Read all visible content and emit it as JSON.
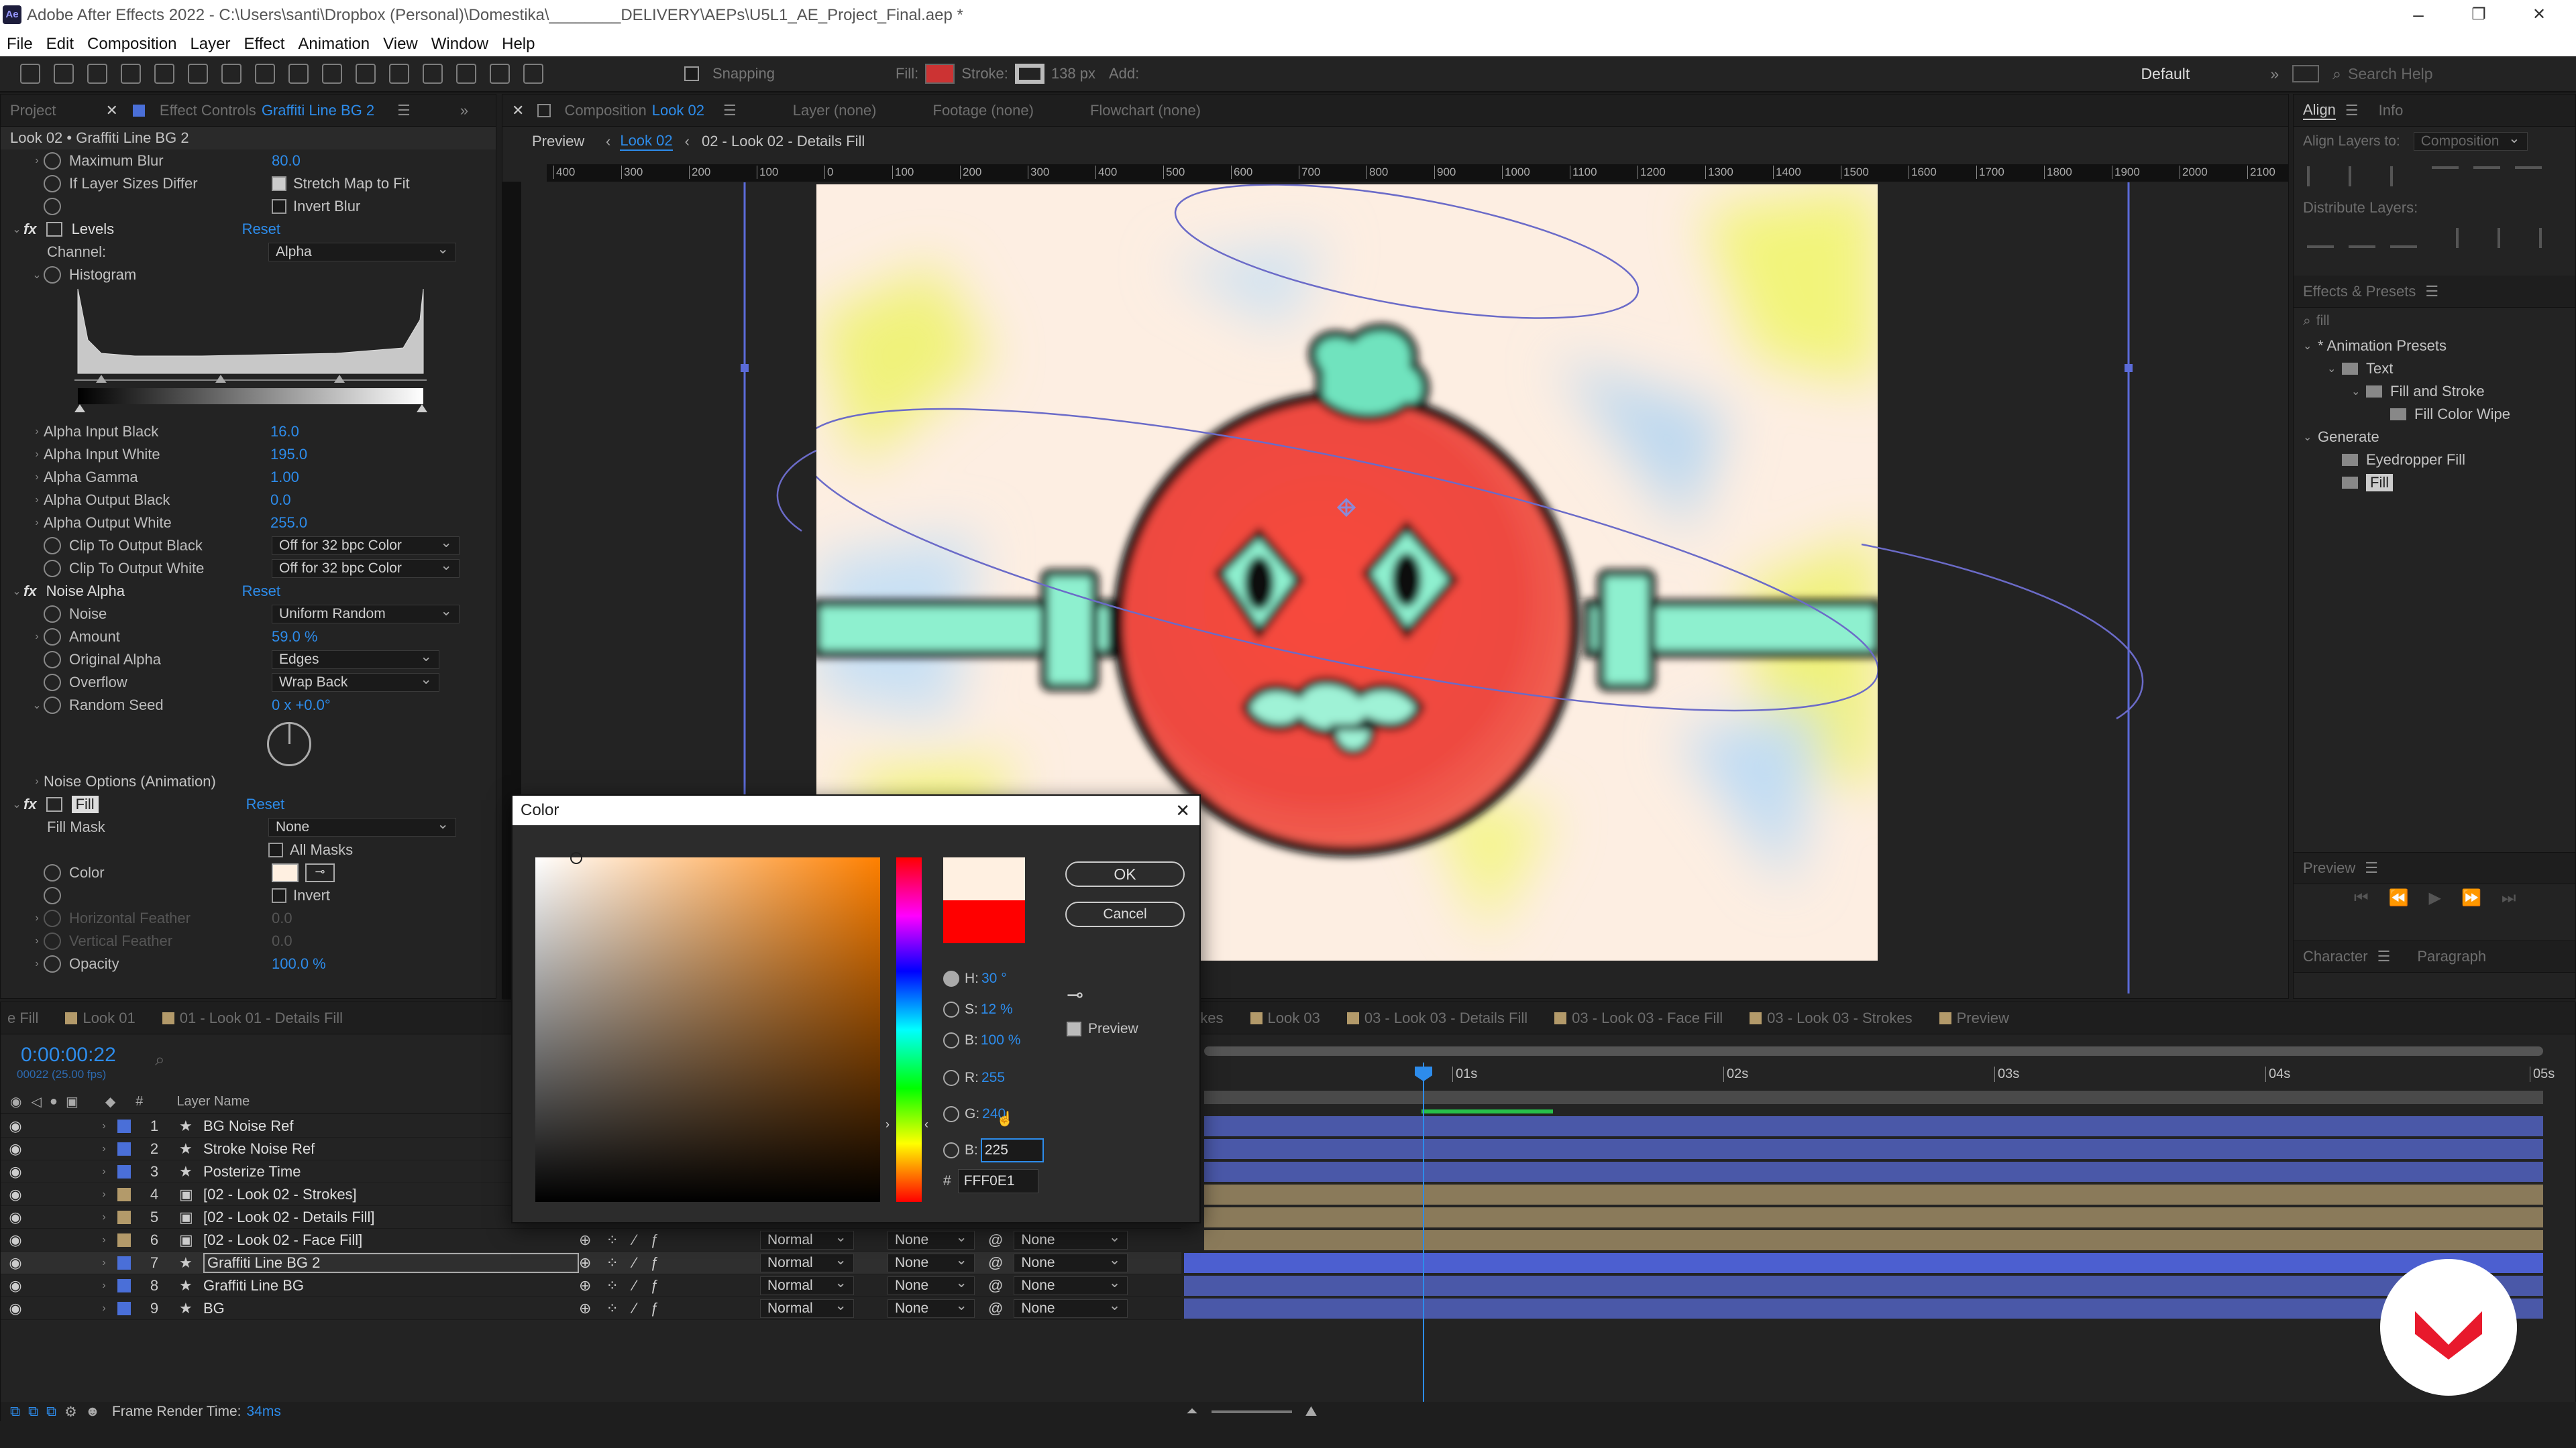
{
  "app": {
    "logo": "Ae",
    "title": "Adobe After Effects 2022 - C:\\Users\\santi\\Dropbox (Personal)\\Domestika\\________DELIVERY\\AEPs\\U5L1_AE_Project_Final.aep *",
    "window_controls": [
      "–",
      "❐",
      "✕"
    ]
  },
  "menu": [
    "File",
    "Edit",
    "Composition",
    "Layer",
    "Effect",
    "Animation",
    "View",
    "Window",
    "Help"
  ],
  "toolbar": {
    "snapping": "Snapping",
    "fill": "Fill:",
    "stroke": "Stroke:",
    "stroke_px": "138 px",
    "add": "Add:",
    "workspace": "Default",
    "search": "Search Help"
  },
  "effect_panel": {
    "tabs": [
      "Project",
      "Effect Controls",
      "Graffiti Line BG 2"
    ],
    "layer_title": "Look 02 • Graffiti Line BG 2",
    "max_blur_label": "Maximum Blur",
    "max_blur_value": "80.0",
    "if_layer_label": "If Layer Sizes Differ",
    "stretch_label": "Stretch Map to Fit",
    "invert_blur_label": "Invert Blur",
    "levels_label": "Levels",
    "reset": "Reset",
    "channel_label": "Channel:",
    "channel_value": "Alpha",
    "histogram_label": "Histogram",
    "params": [
      {
        "label": "Alpha Input Black",
        "value": "16.0"
      },
      {
        "label": "Alpha Input White",
        "value": "195.0"
      },
      {
        "label": "Alpha Gamma",
        "value": "1.00"
      },
      {
        "label": "Alpha Output Black",
        "value": "0.0"
      },
      {
        "label": "Alpha Output White",
        "value": "255.0"
      }
    ],
    "clip_black_label": "Clip To Output Black",
    "clip_white_label": "Clip To Output White",
    "clip_value": "Off for 32 bpc Color",
    "noise_alpha_label": "Noise Alpha",
    "noise_label": "Noise",
    "noise_value": "Uniform Random",
    "amount_label": "Amount",
    "amount_value": "59.0 %",
    "orig_alpha_label": "Original Alpha",
    "orig_alpha_value": "Edges",
    "overflow_label": "Overflow",
    "overflow_value": "Wrap Back",
    "seed_label": "Random Seed",
    "seed_value": "0 x +0.0°",
    "noise_options_label": "Noise Options (Animation)",
    "fill_label": "Fill",
    "fill_mask_label": "Fill Mask",
    "fill_mask_value": "None",
    "all_masks_label": "All Masks",
    "color_label": "Color",
    "invert_label": "Invert",
    "hfeather_label": "Horizontal Feather",
    "hfeather_value": "0.0",
    "vfeather_label": "Vertical Feather",
    "vfeather_value": "0.0",
    "opacity_label": "Opacity",
    "opacity_value": "100.0 %"
  },
  "comp_panel": {
    "tab_composition": "Composition",
    "tab_comp_name": "Look 02",
    "tab_layer": "Layer (none)",
    "tab_footage": "Footage (none)",
    "tab_flowchart": "Flowchart (none)",
    "preview_label": "Preview",
    "breadcrumb_1": "Look 02",
    "breadcrumb_2": "02 - Look 02 - Details Fill",
    "ruler_ticks": [
      "400",
      "300",
      "200",
      "100",
      "0",
      "100",
      "200",
      "300",
      "400",
      "500",
      "600",
      "700",
      "800",
      "900",
      "1000",
      "1100",
      "1200",
      "1300",
      "1400",
      "1500",
      "1600",
      "1700",
      "1800",
      "1900",
      "2000",
      "2100"
    ]
  },
  "right_panel": {
    "align_tab": "Align",
    "info_tab": "Info",
    "align_layers_to": "Align Layers to:",
    "align_target": "Composition",
    "distribute_label": "Distribute Layers:",
    "effects_presets_tab": "Effects & Presets",
    "search_value": "fill",
    "tree": [
      {
        "label": "* Animation Presets",
        "indent": 0
      },
      {
        "label": "Text",
        "indent": 1
      },
      {
        "label": "Fill and Stroke",
        "indent": 2
      },
      {
        "label": "Fill Color Wipe",
        "indent": 3
      },
      {
        "label": "Generate",
        "indent": 0
      },
      {
        "label": "Eyedropper Fill",
        "indent": 1
      },
      {
        "label": "Fill",
        "indent": 1
      }
    ],
    "preview_tab": "Preview",
    "character_tab": "Character",
    "paragraph_tab": "Paragraph"
  },
  "timeline": {
    "tabs": [
      "e Fill",
      "Look 01",
      "01 - Look 01 - Details Fill",
      "02 - Look 02 - Strokes",
      "Look 03",
      "03 - Look 03 - Details Fill",
      "03 - Look 03 - Face Fill",
      "03 - Look 03 - Strokes",
      "Preview"
    ],
    "timecode": "0:00:00:22",
    "fps": "00022 (25.00 fps)",
    "layer_name_header": "Layer Name",
    "time_labels": [
      "01s",
      "02s",
      "03s",
      "04s",
      "05s"
    ],
    "layers": [
      {
        "num": "1",
        "name": "BG Noise Ref",
        "color": "#4a6fd8",
        "mode": "",
        "track": "",
        "parent": ""
      },
      {
        "num": "2",
        "name": "Stroke Noise Ref",
        "color": "#4a6fd8",
        "mode": "",
        "track": "",
        "parent": ""
      },
      {
        "num": "3",
        "name": "Posterize Time",
        "color": "#4a6fd8",
        "mode": "",
        "track": "",
        "parent": ""
      },
      {
        "num": "4",
        "name": "[02 - Look 02 - Strokes]",
        "color": "#b39a6a",
        "mode": "",
        "track": "",
        "parent": ""
      },
      {
        "num": "5",
        "name": "[02 - Look 02 - Details Fill]",
        "color": "#b39a6a",
        "mode": "",
        "track": "",
        "parent": ""
      },
      {
        "num": "6",
        "name": "[02 - Look 02 - Face Fill]",
        "color": "#b39a6a",
        "mode": "Normal",
        "track": "None",
        "parent": "None"
      },
      {
        "num": "7",
        "name": "Graffiti Line BG 2",
        "color": "#4a6fd8",
        "mode": "Normal",
        "track": "None",
        "parent": "None"
      },
      {
        "num": "8",
        "name": "Graffiti Line BG",
        "color": "#4a6fd8",
        "mode": "Normal",
        "track": "None",
        "parent": "None"
      },
      {
        "num": "9",
        "name": "BG",
        "color": "#4a6fd8",
        "mode": "Normal",
        "track": "None",
        "parent": "None"
      }
    ],
    "render_time_label": "Frame Render Time:",
    "render_time_value": "34ms"
  },
  "color_dialog": {
    "title": "Color",
    "ok": "OK",
    "cancel": "Cancel",
    "h_label": "H:",
    "h_value": "30 °",
    "s_label": "S:",
    "s_value": "12 %",
    "b_label": "B:",
    "b_value": "100 %",
    "r_label": "R:",
    "r_value": "255",
    "g_label": "G:",
    "g_value": "240",
    "bb_label": "B:",
    "bb_value": "225",
    "hex_label": "#",
    "hex_value": "FFF0E1",
    "preview_label": "Preview",
    "new_color": "#FFF0E1",
    "old_color": "#FF0000"
  },
  "watermark": {
    "brand_color": "#E8192C"
  }
}
